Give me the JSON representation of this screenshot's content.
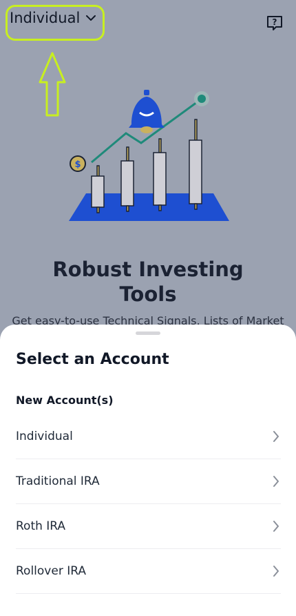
{
  "header": {
    "account_selector_label": "Individual",
    "help_icon": "help-question-icon"
  },
  "hero": {
    "title_line1": "Robust Investing",
    "title_line2": "Tools",
    "subtitle": "Get easy-to-use Technical Signals, Lists of Market"
  },
  "sheet": {
    "title": "Select an Account",
    "section_label": "New Account(s)",
    "accounts": [
      {
        "label": "Individual"
      },
      {
        "label": "Traditional IRA"
      },
      {
        "label": "Roth IRA"
      },
      {
        "label": "Rollover IRA"
      }
    ]
  },
  "colors": {
    "highlight": "#c8ef20",
    "overlay_bg": "#9ba2b1",
    "illustration_blue": "#1e4fd1",
    "chart_line": "#1f8a7a"
  }
}
